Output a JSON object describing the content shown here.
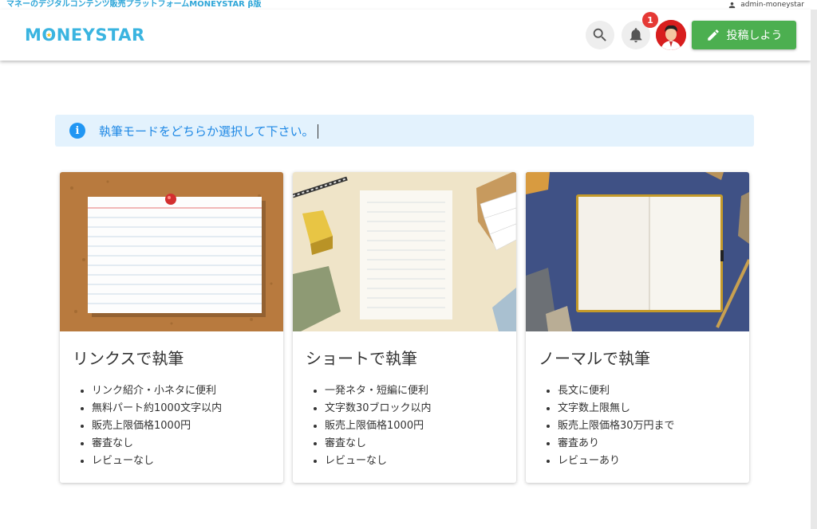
{
  "topbar": {
    "tagline": "マネーのデジタルコンテンツ販売プラットフォームMONEYSTAR β版",
    "username": "admin-moneystar"
  },
  "header": {
    "logo_before": "M",
    "logo_o": "O",
    "logo_after": "NEYSTAR",
    "notification_count": "1",
    "post_button": "投稿しよう"
  },
  "alert": {
    "message": "執筆モードをどちらか選択して下さい。"
  },
  "cards": [
    {
      "title": "リンクスで執筆",
      "features": [
        "リンク紹介・小ネタに便利",
        "無料パート約1000文字以内",
        "販売上限価格1000円",
        "審査なし",
        "レビューなし"
      ]
    },
    {
      "title": "ショートで執筆",
      "features": [
        "一発ネタ・短編に便利",
        "文字数30ブロック以内",
        "販売上限価格1000円",
        "審査なし",
        "レビューなし"
      ]
    },
    {
      "title": "ノーマルで執筆",
      "features": [
        "長文に便利",
        "文字数上限無し",
        "販売上限価格30万円まで",
        "審査あり",
        "レビューあり"
      ]
    }
  ],
  "colors": {
    "brand": "#3ab4e0",
    "post_button": "#4caf50",
    "alert_bg": "#e3f2fd",
    "alert_text": "#1e88e5",
    "badge": "#e53935"
  },
  "icons": [
    "person-icon",
    "search-icon",
    "bell-icon",
    "pencil-icon",
    "info-icon"
  ]
}
